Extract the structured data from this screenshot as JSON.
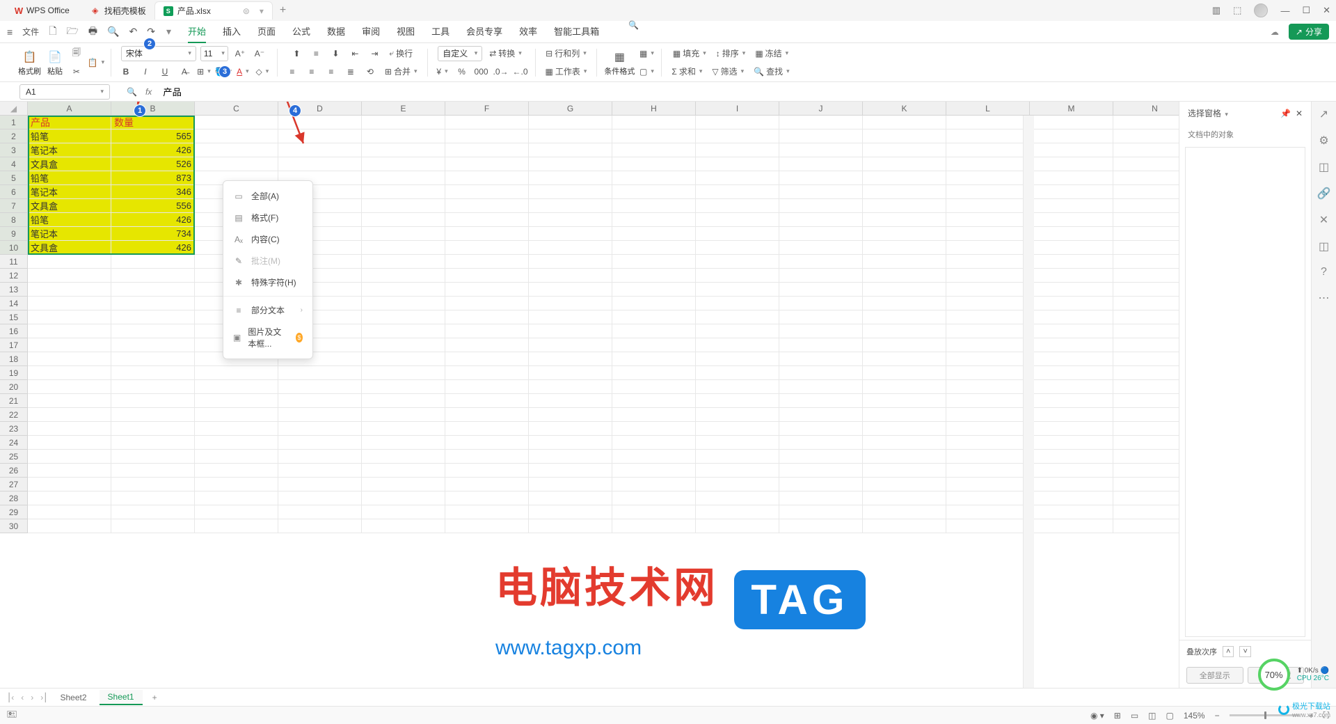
{
  "titlebar": {
    "tabs": [
      {
        "label": "WPS Office",
        "icon": "wps"
      },
      {
        "label": "找稻壳模板",
        "icon": "tpl"
      },
      {
        "label": "产品.xlsx",
        "icon": "xls",
        "active": true
      }
    ],
    "add": "+"
  },
  "menubar": {
    "file": "文件",
    "tabs": [
      "开始",
      "插入",
      "页面",
      "公式",
      "数据",
      "审阅",
      "视图",
      "工具",
      "会员专享",
      "效率",
      "智能工具箱"
    ],
    "active_index": 0,
    "share": "分享"
  },
  "ribbon": {
    "format_painter": "格式刷",
    "paste": "粘贴",
    "font_name": "宋体",
    "font_size": "11",
    "custom_fmt": "自定义",
    "convert": "转换",
    "wrap": "换行",
    "merge": "合并",
    "rowscols": "行和列",
    "worksheet": "工作表",
    "cond_fmt": "条件格式",
    "fill": "填充",
    "sort": "排序",
    "freeze": "冻结",
    "sum": "求和",
    "filter": "筛选",
    "find": "查找"
  },
  "formulabar": {
    "cell_ref": "A1",
    "content": "产品"
  },
  "grid": {
    "columns": [
      "A",
      "B",
      "C",
      "D",
      "E",
      "F",
      "G",
      "H",
      "I",
      "J",
      "K",
      "L",
      "M",
      "N"
    ],
    "row_count": 30,
    "data": [
      {
        "a": "产品",
        "b": "数量"
      },
      {
        "a": "铅笔",
        "b": "565"
      },
      {
        "a": "笔记本",
        "b": "426"
      },
      {
        "a": "文具盒",
        "b": "526"
      },
      {
        "a": "铅笔",
        "b": "873"
      },
      {
        "a": "笔记本",
        "b": "346"
      },
      {
        "a": "文具盒",
        "b": "556"
      },
      {
        "a": "铅笔",
        "b": "426"
      },
      {
        "a": "笔记本",
        "b": "734"
      },
      {
        "a": "文具盒",
        "b": "426"
      }
    ]
  },
  "dropdown": {
    "items": [
      {
        "label": "全部(A)",
        "icon": "▭"
      },
      {
        "label": "格式(F)",
        "icon": "▤"
      },
      {
        "label": "内容(C)",
        "icon": "A"
      },
      {
        "label": "批注(M)",
        "icon": "✎",
        "disabled": true
      },
      {
        "label": "特殊字符(H)",
        "icon": "✱"
      }
    ],
    "sep_items": [
      {
        "label": "部分文本",
        "icon": "≡",
        "arrow": true
      },
      {
        "label": "图片及文本框...",
        "icon": "▣",
        "badge": "$"
      }
    ]
  },
  "rightpanel": {
    "title": "选择窗格",
    "subtitle": "文档中的对象",
    "order_label": "叠放次序",
    "show_all": "全部显示",
    "hide_all": "全部隐藏"
  },
  "sheets": {
    "tabs": [
      "Sheet2",
      "Sheet1"
    ],
    "active_index": 1
  },
  "statusbar": {
    "zoom": "145%"
  },
  "watermark": {
    "title": "电脑技术网",
    "tag": "TAG",
    "url": "www.tagxp.com"
  },
  "perf": {
    "percent": "70%",
    "net": "0K/s",
    "cpu": "CPU 26°C"
  },
  "footer_logo": {
    "name": "极光下载站",
    "url": "www.xz7.com"
  }
}
